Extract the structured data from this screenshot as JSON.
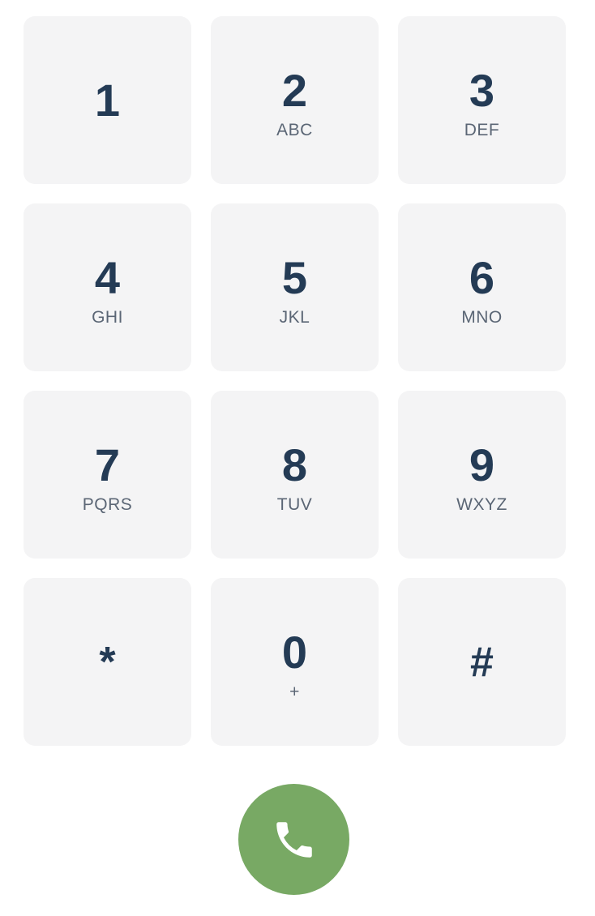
{
  "keypad": {
    "keys": [
      {
        "digit": "1",
        "letters": ""
      },
      {
        "digit": "2",
        "letters": "ABC"
      },
      {
        "digit": "3",
        "letters": "DEF"
      },
      {
        "digit": "4",
        "letters": "GHI"
      },
      {
        "digit": "5",
        "letters": "JKL"
      },
      {
        "digit": "6",
        "letters": "MNO"
      },
      {
        "digit": "7",
        "letters": "PQRS"
      },
      {
        "digit": "8",
        "letters": "TUV"
      },
      {
        "digit": "9",
        "letters": "WXYZ"
      },
      {
        "digit": "*",
        "letters": ""
      },
      {
        "digit": "0",
        "letters": "+"
      },
      {
        "digit": "#",
        "letters": ""
      }
    ]
  },
  "call_button": {
    "icon": "phone-icon",
    "color": "#78a964"
  },
  "colors": {
    "key_background": "#f4f4f5",
    "digit_text": "#243b55",
    "letters_text": "#5b6675"
  }
}
